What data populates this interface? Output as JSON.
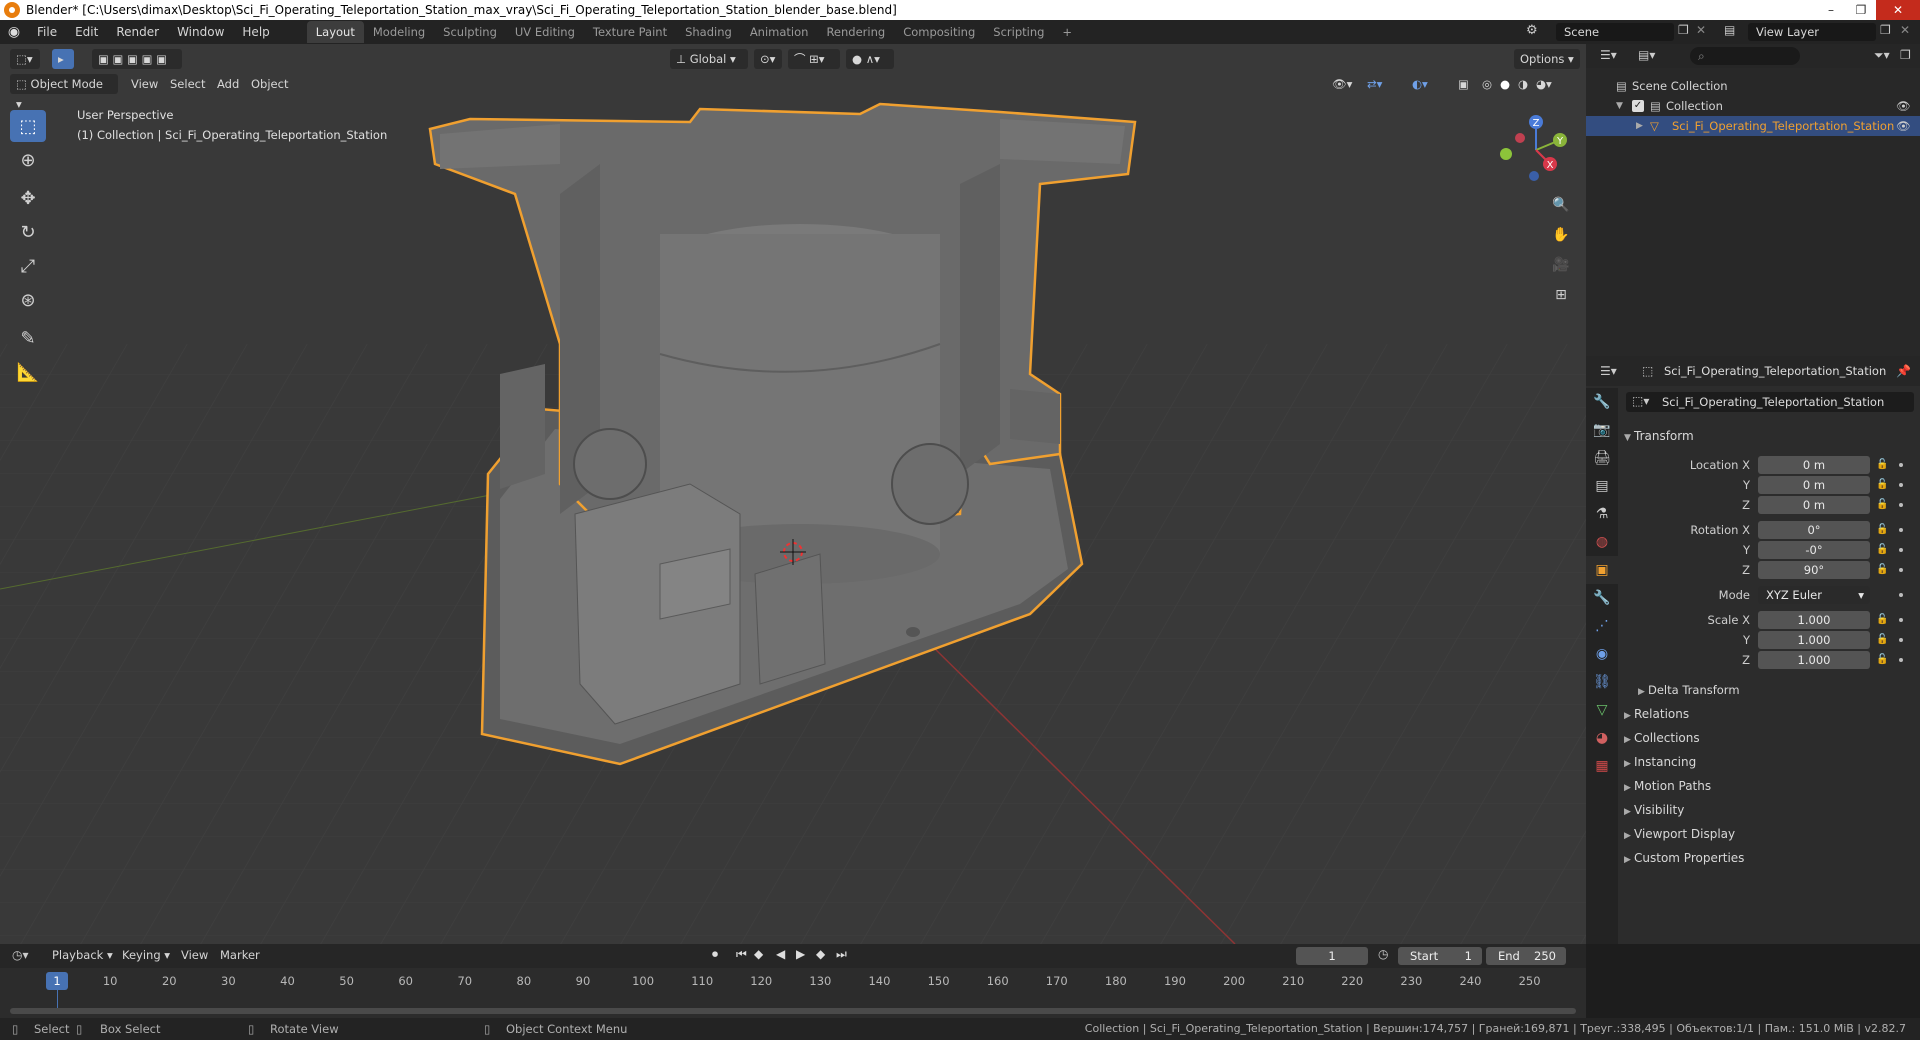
{
  "window": {
    "title": "Blender* [C:\\Users\\dimax\\Desktop\\Sci_Fi_Operating_Teleportation_Station_max_vray\\Sci_Fi_Operating_Teleportation_Station_blender_base.blend]",
    "min": "–",
    "max": "❐",
    "close": "✕"
  },
  "menu": [
    "File",
    "Edit",
    "Render",
    "Window",
    "Help"
  ],
  "workspaces": [
    "Layout",
    "Modeling",
    "Sculpting",
    "UV Editing",
    "Texture Paint",
    "Shading",
    "Animation",
    "Rendering",
    "Compositing",
    "Scripting"
  ],
  "workspace_add": "+",
  "scene": {
    "name": "Scene",
    "view_layer": "View Layer"
  },
  "viewport": {
    "mode": "Object Mode",
    "menus": [
      "View",
      "Select",
      "Add",
      "Object"
    ],
    "transform_orientation": "Global",
    "options": "Options",
    "overlay_title": "User Perspective",
    "overlay_collection": "(1) Collection | Sci_Fi_Operating_Teleportation_Station",
    "gizmo": {
      "z": "Z",
      "y": "Y",
      "x": "X"
    }
  },
  "outliner": {
    "search_placeholder": "",
    "scene_collection": "Scene Collection",
    "collection": "Collection",
    "object": "Sci_Fi_Operating_Teleportation_Station"
  },
  "properties": {
    "header_object": "Sci_Fi_Operating_Teleportation_Station",
    "object_name": "Sci_Fi_Operating_Teleportation_Station",
    "transform_title": "Transform",
    "location": {
      "label": "Location X",
      "x": "0 m",
      "y": "0 m",
      "z": "0 m"
    },
    "rotation": {
      "label": "Rotation X",
      "x": "0°",
      "y": "-0°",
      "z": "90°"
    },
    "axis_y": "Y",
    "axis_z": "Z",
    "mode_label": "Mode",
    "mode_value": "XYZ Euler",
    "scale": {
      "label": "Scale X",
      "x": "1.000",
      "y": "1.000",
      "z": "1.000"
    },
    "delta_transform": "Delta Transform",
    "panels": [
      "Relations",
      "Collections",
      "Instancing",
      "Motion Paths",
      "Visibility",
      "Viewport Display",
      "Custom Properties"
    ]
  },
  "timeline": {
    "menus": [
      "Playback",
      "Keying",
      "View",
      "Marker"
    ],
    "current_frame": "1",
    "start_label": "Start",
    "start": "1",
    "end_label": "End",
    "end": "250",
    "ruler": [
      "1",
      "10",
      "20",
      "30",
      "40",
      "50",
      "60",
      "70",
      "80",
      "90",
      "100",
      "110",
      "120",
      "130",
      "140",
      "150",
      "160",
      "170",
      "180",
      "190",
      "200",
      "210",
      "220",
      "230",
      "240",
      "250"
    ]
  },
  "statusbar": {
    "select": "Select",
    "box_select": "Box Select",
    "rotate_view": "Rotate View",
    "context_menu": "Object Context Menu",
    "stats": "Collection | Sci_Fi_Operating_Teleportation_Station | Вершин:174,757 | Граней:169,871 | Треуг.:338,495 | Объектов:1/1 | Пам.: 151.0 MiB | v2.82.7"
  },
  "colors": {
    "accent": "#4772b3",
    "selection": "#f0a030",
    "viewport_bg": "#393939"
  }
}
